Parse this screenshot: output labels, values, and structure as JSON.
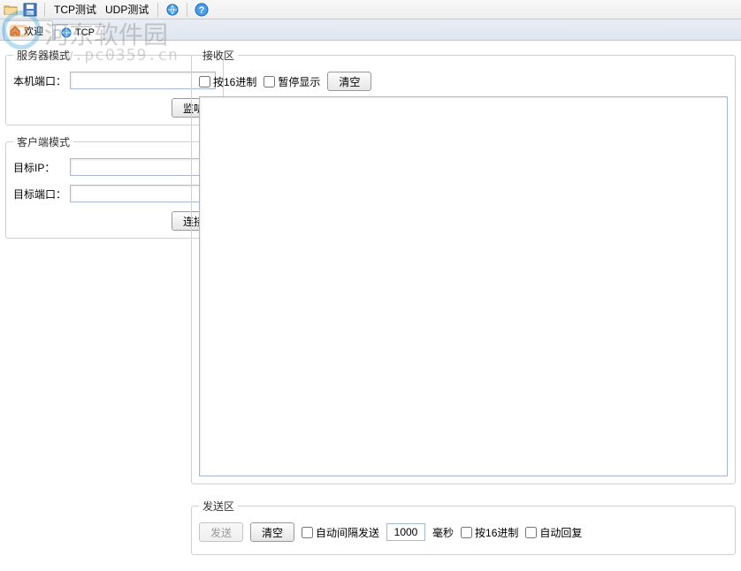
{
  "toolbar": {
    "tcp_test": "TCP测试",
    "udp_test": "UDP测试"
  },
  "tabs": {
    "welcome": "欢迎",
    "tcp": "TCP"
  },
  "server_mode": {
    "legend": "服务器模式",
    "local_port_label": "本机端口：",
    "local_port_value": "",
    "listen_btn": "监听"
  },
  "client_mode": {
    "legend": "客户端模式",
    "target_ip_label": "目标IP：",
    "target_ip_value": "",
    "target_port_label": "目标端口：",
    "target_port_value": "",
    "connect_btn": "连接"
  },
  "recv": {
    "legend": "接收区",
    "hex_label": "按16进制",
    "pause_label": "暂停显示",
    "clear_btn": "清空"
  },
  "send": {
    "legend": "发送区",
    "send_btn": "发送",
    "clear_btn": "清空",
    "auto_interval_label": "自动间隔发送",
    "interval_value": "1000",
    "ms_label": "毫秒",
    "hex_label": "按16进制",
    "auto_reply_label": "自动回复"
  },
  "watermark": {
    "title": "河东软件园",
    "url": "www.pc0359.cn"
  }
}
